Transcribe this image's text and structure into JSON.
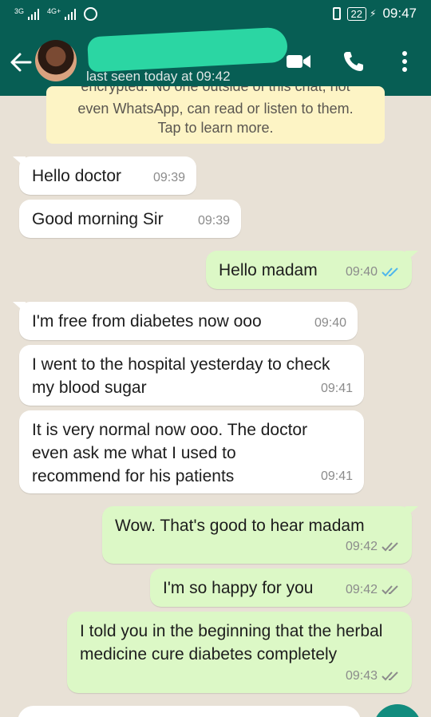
{
  "status_bar": {
    "net1": "3G",
    "net2": "4G+",
    "battery": "22",
    "time": "09:47"
  },
  "header": {
    "last_seen": "last seen today at 09:42",
    "icons": [
      "back-arrow-icon",
      "video-call-icon",
      "voice-call-icon",
      "more-options-icon"
    ]
  },
  "encryption_notice": {
    "line_cut": "encrypted. No one outside of this chat, not",
    "line1": "even WhatsApp, can read or listen to them.",
    "line2": "Tap to learn more."
  },
  "messages": [
    {
      "direction": "in",
      "text": "Hello doctor",
      "time": "09:39"
    },
    {
      "direction": "in",
      "text": "Good morning Sir",
      "time": "09:39"
    },
    {
      "direction": "out",
      "text": "Hello madam",
      "time": "09:40",
      "status": "read"
    },
    {
      "direction": "in",
      "text": "I'm free from diabetes now ooo",
      "time": "09:40"
    },
    {
      "direction": "in",
      "text": "I went to the hospital yesterday to check my blood sugar",
      "time": "09:41"
    },
    {
      "direction": "in",
      "text": "It is very normal now ooo. The doctor even ask me what I used to recommend for his patients",
      "time": "09:41"
    },
    {
      "direction": "out",
      "text": "Wow. That's good to hear madam",
      "time": "09:42",
      "status": "delivered"
    },
    {
      "direction": "out",
      "text": "I'm so happy for you",
      "time": "09:42",
      "status": "delivered"
    },
    {
      "direction": "out",
      "text": "I told you in the beginning that the herbal medicine cure diabetes completely",
      "time": "09:43",
      "status": "delivered"
    }
  ],
  "colors": {
    "header": "#075e54",
    "outgoing_bubble": "#dcf8c6",
    "incoming_bubble": "#ffffff",
    "read_tick": "#4fb6ec",
    "delivered_tick": "#8b8b8b",
    "chat_background": "#e8e1d6"
  }
}
